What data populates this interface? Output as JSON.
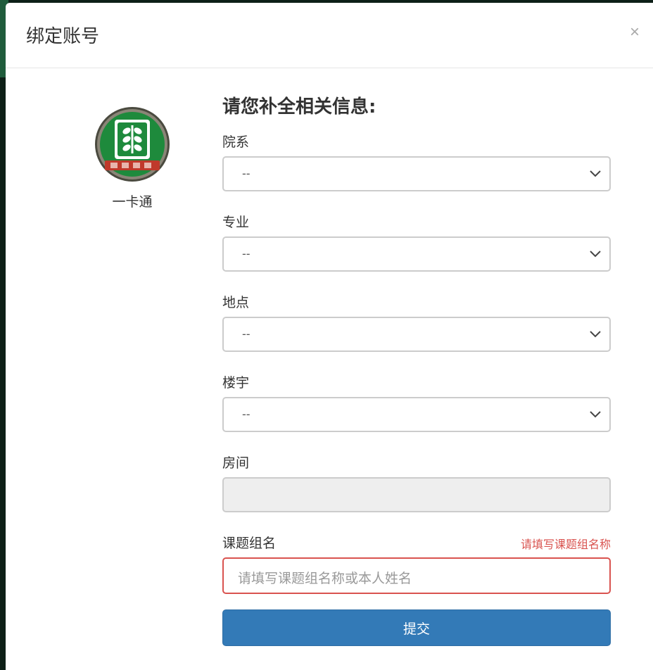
{
  "modal": {
    "title": "绑定账号",
    "close_glyph": "×"
  },
  "logo": {
    "label": "一卡通",
    "icon": "wheat-emblem-icon"
  },
  "form": {
    "heading": "请您补全相关信息:",
    "department": {
      "label": "院系",
      "value": "--"
    },
    "major": {
      "label": "专业",
      "value": "--"
    },
    "location": {
      "label": "地点",
      "value": "--"
    },
    "building": {
      "label": "楼宇",
      "value": "--"
    },
    "room": {
      "label": "房间",
      "value": ""
    },
    "group_name": {
      "label": "课题组名",
      "error": "请填写课题组名称",
      "placeholder": "请填写课题组名称或本人姓名"
    },
    "submit_label": "提交"
  },
  "colors": {
    "primary": "#337ab7",
    "error": "#d9534f",
    "emblem_green": "#1e8a3c",
    "emblem_red": "#c0392b"
  }
}
